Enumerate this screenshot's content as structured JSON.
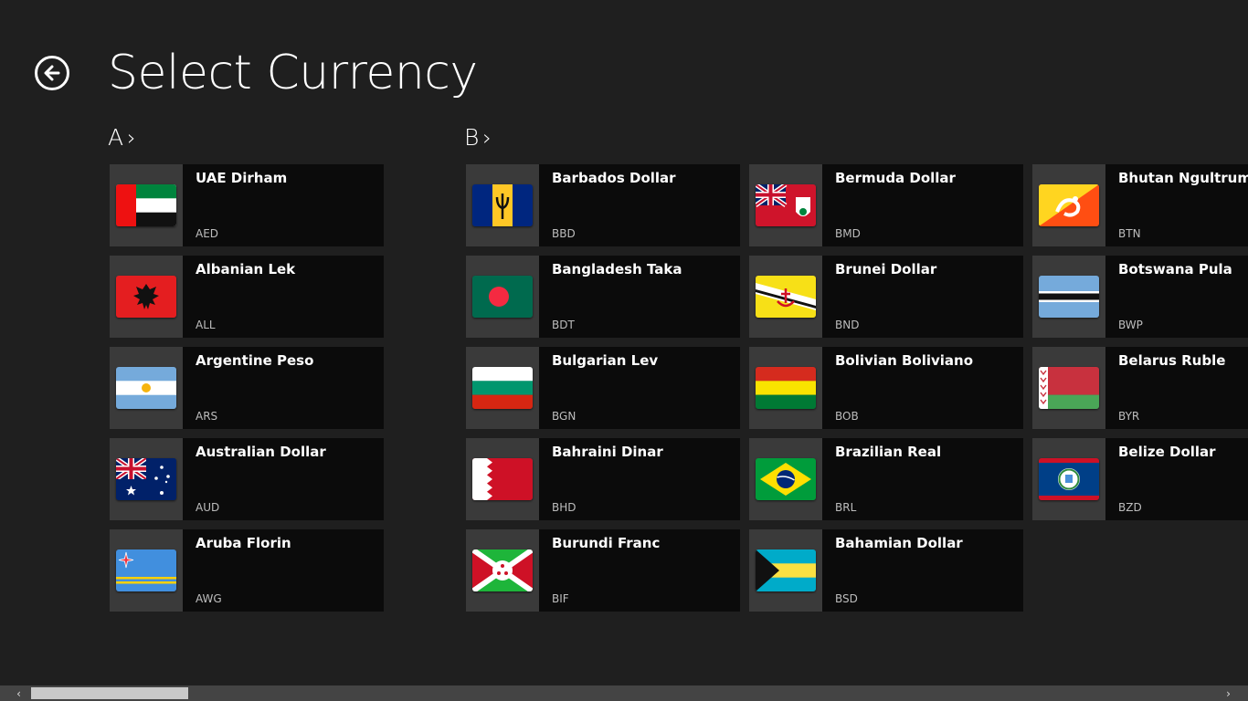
{
  "title": "Select Currency",
  "groups": [
    {
      "letter": "A",
      "chevron": "›"
    },
    {
      "letter": "B",
      "chevron": "›"
    }
  ],
  "currencies": {
    "A": [
      {
        "name": "UAE Dirham",
        "code": "AED",
        "flag": "uae-flag-icon"
      },
      {
        "name": "Albanian Lek",
        "code": "ALL",
        "flag": "albania-flag-icon"
      },
      {
        "name": "Argentine Peso",
        "code": "ARS",
        "flag": "argentina-flag-icon"
      },
      {
        "name": "Australian Dollar",
        "code": "AUD",
        "flag": "australia-flag-icon"
      },
      {
        "name": "Aruba Florin",
        "code": "AWG",
        "flag": "aruba-flag-icon"
      }
    ],
    "B": [
      {
        "name": "Barbados Dollar",
        "code": "BBD",
        "flag": "barbados-flag-icon"
      },
      {
        "name": "Bangladesh Taka",
        "code": "BDT",
        "flag": "bangladesh-flag-icon"
      },
      {
        "name": "Bulgarian Lev",
        "code": "BGN",
        "flag": "bulgaria-flag-icon"
      },
      {
        "name": "Bahraini Dinar",
        "code": "BHD",
        "flag": "bahrain-flag-icon"
      },
      {
        "name": "Burundi Franc",
        "code": "BIF",
        "flag": "burundi-flag-icon"
      },
      {
        "name": "Bermuda Dollar",
        "code": "BMD",
        "flag": "bermuda-flag-icon"
      },
      {
        "name": "Brunei Dollar",
        "code": "BND",
        "flag": "brunei-flag-icon"
      },
      {
        "name": "Bolivian Boliviano",
        "code": "BOB",
        "flag": "bolivia-flag-icon"
      },
      {
        "name": "Brazilian Real",
        "code": "BRL",
        "flag": "brazil-flag-icon"
      },
      {
        "name": "Bahamian Dollar",
        "code": "BSD",
        "flag": "bahamas-flag-icon"
      },
      {
        "name": "Bhutan Ngultrum",
        "code": "BTN",
        "flag": "bhutan-flag-icon"
      },
      {
        "name": "Botswana Pula",
        "code": "BWP",
        "flag": "botswana-flag-icon"
      },
      {
        "name": "Belarus Ruble",
        "code": "BYR",
        "flag": "belarus-flag-icon"
      },
      {
        "name": "Belize Dollar",
        "code": "BZD",
        "flag": "belize-flag-icon"
      }
    ]
  },
  "scrollbar": {
    "left_arrow": "‹",
    "right_arrow": "›"
  }
}
